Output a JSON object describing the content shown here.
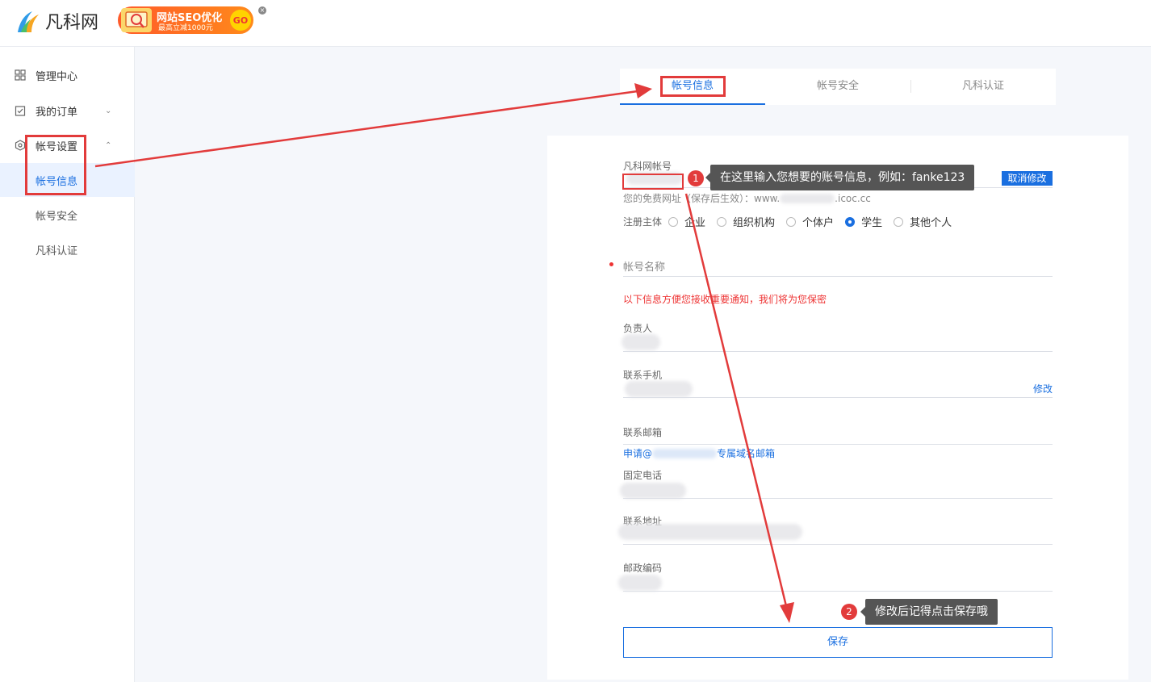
{
  "header": {
    "logo_text": "凡科网",
    "ad_title": "网站SEO优化",
    "ad_subtitle": "最高立减1000元",
    "ad_go": "GO",
    "ad_close": "×"
  },
  "sidebar": {
    "items": [
      {
        "label": "管理中心",
        "icon": "grid-icon"
      },
      {
        "label": "我的订单",
        "icon": "order-icon",
        "chevron": "⌄"
      },
      {
        "label": "帐号设置",
        "icon": "settings-icon",
        "chevron": "⌃"
      }
    ],
    "subitems": [
      {
        "label": "帐号信息",
        "active": true
      },
      {
        "label": "帐号安全",
        "active": false
      },
      {
        "label": "凡科认证",
        "active": false
      }
    ]
  },
  "tabs": [
    {
      "label": "帐号信息",
      "active": true
    },
    {
      "label": "帐号安全",
      "active": false
    },
    {
      "label": "凡科认证",
      "active": false
    }
  ],
  "form": {
    "account_label": "凡科网帐号",
    "cancel_edit": "取消修改",
    "free_site_hint_prefix": "您的免费网址（保存后生效）：www.",
    "free_site_hint_suffix": ".icoc.cc",
    "entity_label": "注册主体",
    "entity_options": [
      "企业",
      "组织机构",
      "个体户",
      "学生",
      "其他个人"
    ],
    "entity_selected": "学生",
    "account_name_label": "帐号名称",
    "notice": "以下信息方便您接收重要通知，我们将为您保密",
    "person_label": "负责人",
    "phone_label": "联系手机",
    "phone_edit": "修改",
    "email_label": "联系邮箱",
    "email_apply_prefix": "申请@",
    "email_apply_suffix": "专属域名邮箱",
    "landline_label": "固定电话",
    "address_label": "联系地址",
    "zip_label": "邮政编码",
    "save": "保存"
  },
  "annotations": {
    "step1_num": "1",
    "step1_text": "在这里输入您想要的账号信息，例如：fanke123",
    "step2_num": "2",
    "step2_text": "修改后记得点击保存哦"
  },
  "colors": {
    "accent": "#1a6fe0",
    "annotation_red": "#e23b3b",
    "tooltip_bg": "#555555"
  }
}
